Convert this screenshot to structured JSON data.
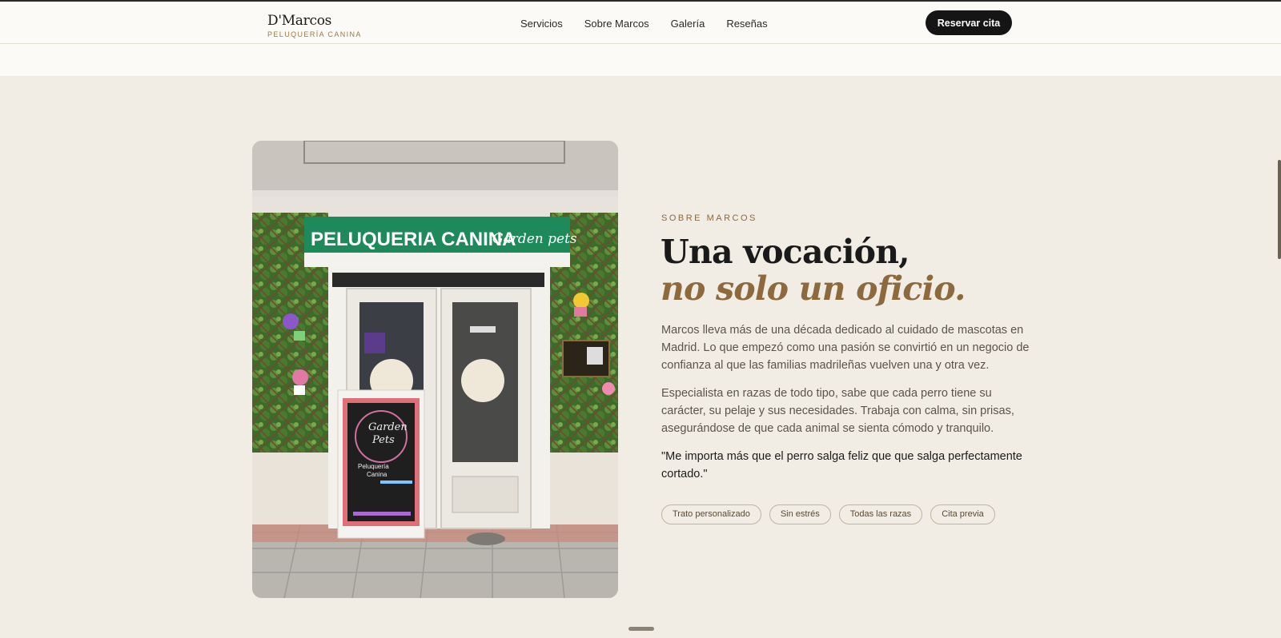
{
  "brand": {
    "name": "D'Marcos",
    "tagline": "PELUQUERÍA CANINA"
  },
  "nav": {
    "items": [
      {
        "label": "Servicios"
      },
      {
        "label": "Sobre Marcos"
      },
      {
        "label": "Galería"
      },
      {
        "label": "Reseñas"
      }
    ],
    "cta_label": "Reservar cita"
  },
  "about": {
    "eyebrow": "SOBRE MARCOS",
    "headline_line1": "Una vocación,",
    "headline_line2": "no solo un oficio.",
    "paragraph1": "Marcos lleva más de una década dedicado al cuidado de mascotas en Madrid. Lo que empezó como una pasión se convirtió en un negocio de confianza al que las familias madrileñas vuelven una y otra vez.",
    "paragraph2": "Especialista en razas de todo tipo, sabe que cada perro tiene su carácter, su pelaje y sus necesidades. Trabaja con calma, sin prisas, asegurándose de que cada animal se sienta cómodo y tranquilo.",
    "quote": "\"Me importa más que el perro salga feliz que que salga perfectamente cortado.\"",
    "tags": [
      "Trato personalizado",
      "Sin estrés",
      "Todas las razas",
      "Cita previa"
    ]
  },
  "photo": {
    "sign_text": "PELUQUERIA CANINA",
    "sign_script": "Garden pets",
    "board_text1": "Garden",
    "board_text2": "Pets",
    "board_text3": "Peluquería",
    "board_text4": "Canina"
  },
  "colors": {
    "accent": "#8d6a3d",
    "background": "#f1ece4",
    "header_bg": "#fbfaf6",
    "cta_bg": "#151515",
    "sign_green": "#1e8a5c"
  }
}
